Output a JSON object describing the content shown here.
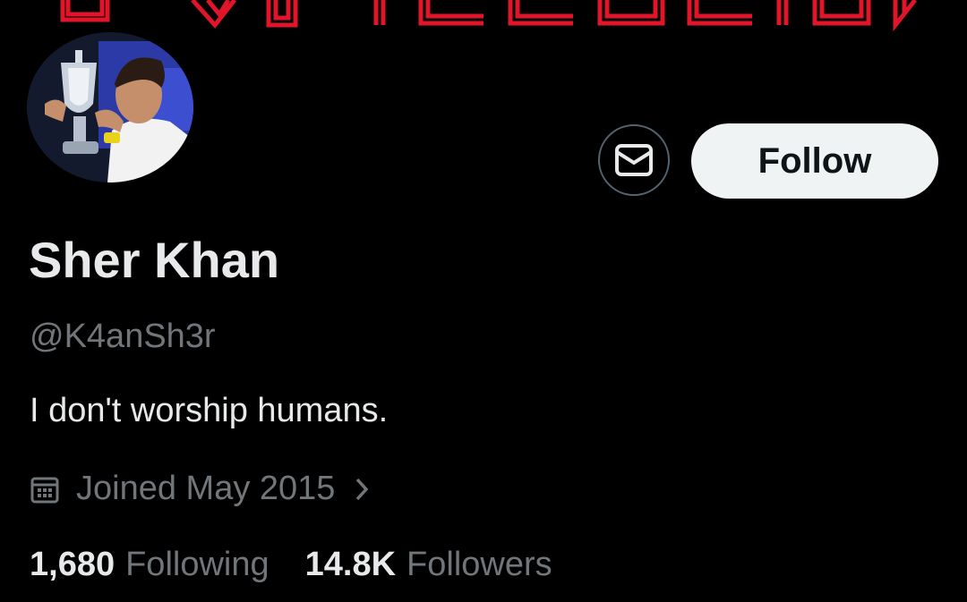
{
  "profile": {
    "display_name": "Sher Khan",
    "handle": "@K4anSh3r",
    "bio": "I don't worship humans.",
    "joined": "Joined May 2015"
  },
  "actions": {
    "follow_label": "Follow"
  },
  "stats": {
    "following_count": "1,680",
    "following_label": "Following",
    "followers_count": "14.8K",
    "followers_label": "Followers"
  },
  "colors": {
    "background": "#000000",
    "primary_text": "#e7e9ea",
    "secondary_text": "#71767b",
    "button_bg": "#eff3f4",
    "banner_accent": "#e0152a"
  },
  "icons": {
    "message": "envelope-icon",
    "calendar": "calendar-icon",
    "chevron": "chevron-right-icon"
  }
}
